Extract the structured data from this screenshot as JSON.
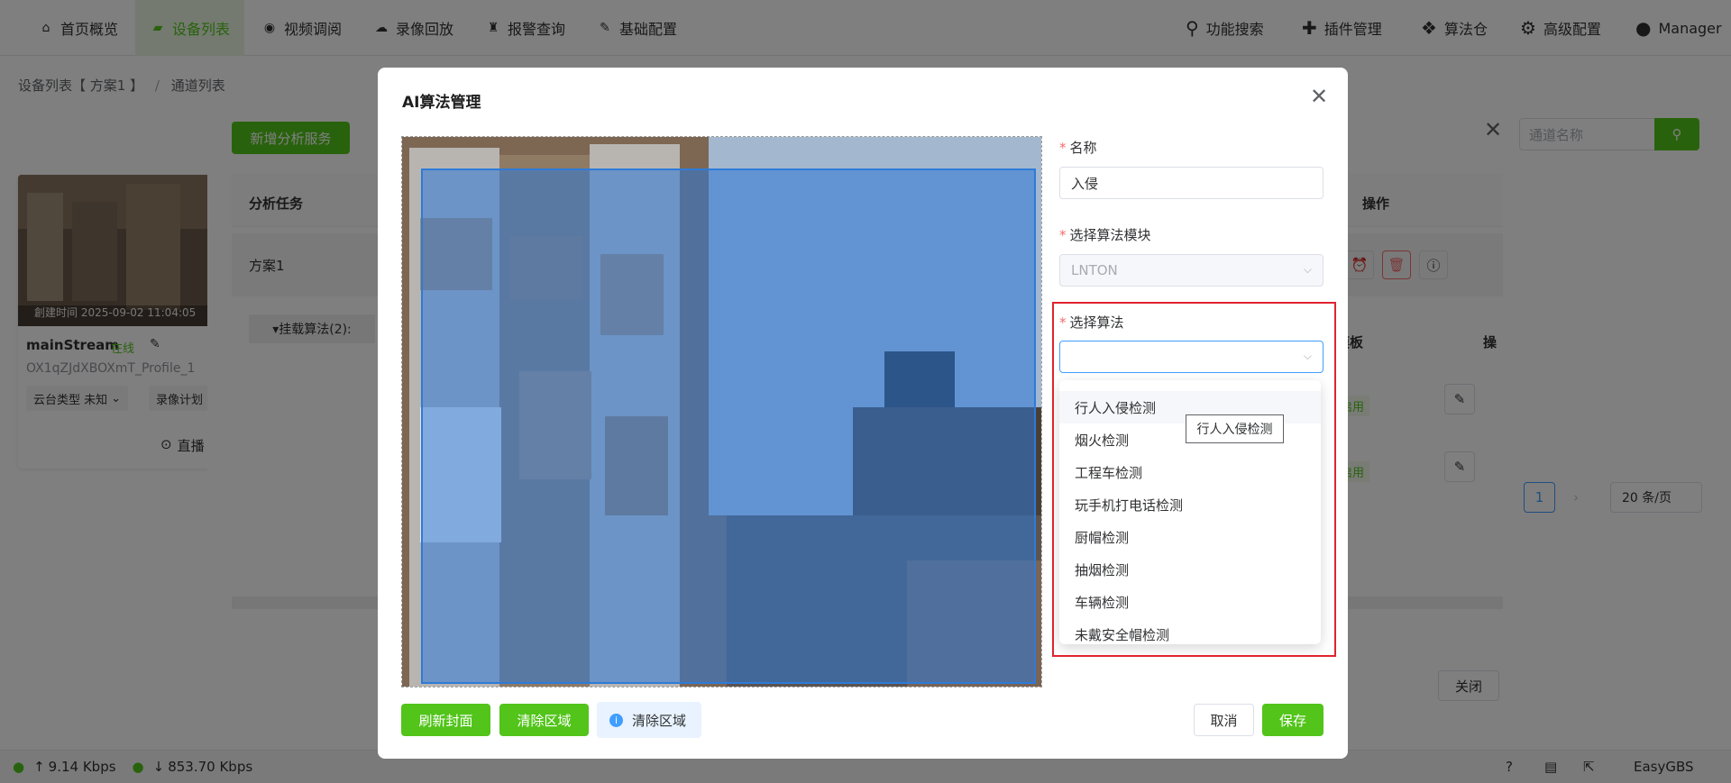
{
  "topnav": {
    "items": [
      {
        "label": "首页概览",
        "icon": "home-icon"
      },
      {
        "label": "设备列表",
        "icon": "device-icon",
        "active": true
      },
      {
        "label": "视频调阅",
        "icon": "play-icon"
      },
      {
        "label": "录像回放",
        "icon": "cloud-icon"
      },
      {
        "label": "报警查询",
        "icon": "alarm-icon"
      },
      {
        "label": "基础配置",
        "icon": "edit-icon"
      }
    ],
    "right": [
      {
        "label": "功能搜索",
        "icon": "search-icon"
      },
      {
        "label": "插件管理",
        "icon": "puzzle-icon"
      },
      {
        "label": "算法仓",
        "icon": "dropbox-icon"
      },
      {
        "label": "高级配置",
        "icon": "gear-icon"
      },
      {
        "label": "Manager",
        "icon": "user-icon"
      }
    ]
  },
  "breadcrumb": {
    "part1": "设备列表【 方案1 】",
    "sep": "/",
    "part2": "通道列表"
  },
  "device_card": {
    "created": "創建时间 2025-09-02 11:04:05",
    "stream": "mainStream",
    "status": "在线",
    "profile": "OX1qZJdXBOXmT_Profile_1",
    "ptz": "云台类型 未知",
    "record": "录像计划",
    "live": "直播"
  },
  "bg_dialog": {
    "add_button": "新增分析服务",
    "search_placeholder": "通道名称",
    "col_task": "分析任务",
    "col_ops": "操作",
    "row_plan": "方案1",
    "mounted": "▾挂载算法(2):",
    "col_template": "模板",
    "col_ops2": "操",
    "badge1": "启用",
    "badge2": "启用",
    "page": "1",
    "page_size": "20 条/页",
    "close": "关闭"
  },
  "bottombar": {
    "up": "9.14 Kbps",
    "down": "853.70 Kbps",
    "brand": "EasyGBS"
  },
  "modal": {
    "title": "AI算法管理",
    "name_label": "名称",
    "name_value": "入侵",
    "module_label": "选择算法模块",
    "module_value": "LNTON",
    "algo_label": "选择算法",
    "algo_value": "",
    "options": [
      "行人入侵检测",
      "烟火检测",
      "工程车检测",
      "玩手机打电话检测",
      "厨帽检测",
      "抽烟检测",
      "车辆检测",
      "未戴安全帽检测"
    ],
    "tooltip": "行人入侵检测",
    "btn_refresh": "刷新封面",
    "btn_clear": "清除区域",
    "info_clear": "清除区域",
    "btn_cancel": "取消",
    "btn_save": "保存"
  },
  "colors": {
    "green": "#52c41a",
    "red": "#e0242f",
    "blue": "#409eff"
  }
}
